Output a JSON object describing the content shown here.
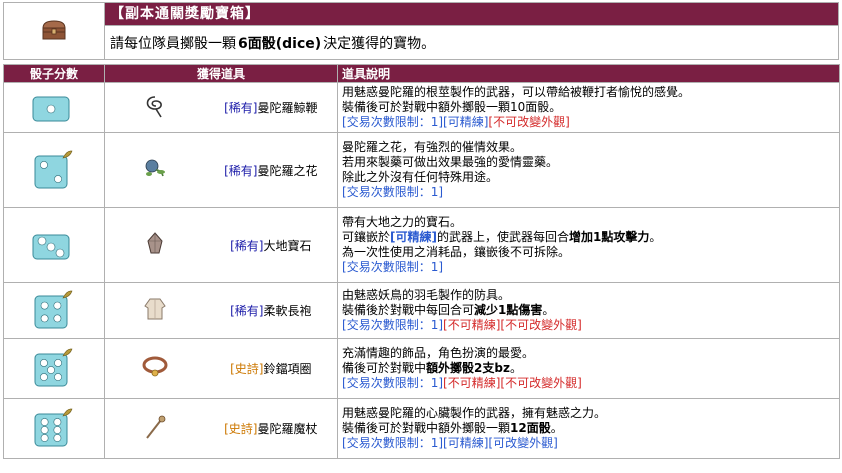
{
  "header": {
    "title": "【副本通關獎勵寶箱】",
    "icon": "treasure-chest-icon",
    "desc_prefix": "請每位隊員擲骰一顆",
    "desc_bold": "6面骰(dice)",
    "desc_suffix": "決定獲得的寶物。"
  },
  "columns": {
    "dice": "骰子分數",
    "item": "獲得道具",
    "desc": "道具說明"
  },
  "rows": [
    {
      "dice_face": 1,
      "item_icon": "whip-icon",
      "item_tag": "[稀有]",
      "item_tag_class": "rare",
      "item_name": "曼陀羅鯨鞭",
      "desc": [
        [
          {
            "t": "用魅惑曼陀羅的根莖製作的武器，可以帶給被鞭打者愉悅的感覺。"
          }
        ],
        [
          {
            "t": "裝備後可於對戰中額外擲骰一顆10面骰。"
          }
        ],
        [
          {
            "t": "[交易次數限制：1]",
            "c": "blue"
          },
          {
            "t": "[可精練]",
            "c": "blue"
          },
          {
            "t": "[不可改變外觀]",
            "c": "red"
          }
        ]
      ]
    },
    {
      "dice_face": 2,
      "item_icon": "flower-icon",
      "item_tag": "[稀有]",
      "item_tag_class": "rare",
      "item_name": "曼陀羅之花",
      "desc": [
        [
          {
            "t": "曼陀羅之花，有強烈的催情效果。"
          }
        ],
        [
          {
            "t": "若用來製藥可做出效果最強的愛情靈藥。"
          }
        ],
        [
          {
            "t": "除此之外沒有任何特殊用途。"
          }
        ],
        [
          {
            "t": "[交易次數限制：1]",
            "c": "blue"
          }
        ]
      ]
    },
    {
      "dice_face": 3,
      "item_icon": "gem-icon",
      "item_tag": "[稀有]",
      "item_tag_class": "rare",
      "item_name": "大地寶石",
      "desc": [
        [
          {
            "t": "帶有大地之力的寶石。"
          }
        ],
        [
          {
            "t": "可鑲嵌於"
          },
          {
            "t": "[可精練]",
            "c": "blue bold"
          },
          {
            "t": "的武器上，使武器每回合"
          },
          {
            "t": "增加1點攻擊力",
            "c": "bold"
          },
          {
            "t": "。"
          }
        ],
        [
          {
            "t": "為一次性使用之消耗品，鑲嵌後不可拆除。"
          }
        ],
        [
          {
            "t": "[交易次數限制：1]",
            "c": "blue"
          }
        ]
      ]
    },
    {
      "dice_face": 4,
      "item_icon": "robe-icon",
      "item_tag": "[稀有]",
      "item_tag_class": "rare",
      "item_name": "柔軟長袍",
      "desc": [
        [
          {
            "t": "由魅惑妖鳥的羽毛製作的防具。"
          }
        ],
        [
          {
            "t": "裝備後於對戰中每回合可"
          },
          {
            "t": "減少1點傷害",
            "c": "bold"
          },
          {
            "t": "。"
          }
        ],
        [
          {
            "t": "[交易次數限制：1]",
            "c": "blue"
          },
          {
            "t": "[不可精練]",
            "c": "red"
          },
          {
            "t": "[不可改變外觀]",
            "c": "red"
          }
        ]
      ]
    },
    {
      "dice_face": 5,
      "item_icon": "collar-icon",
      "item_tag": "[史詩]",
      "item_tag_class": "epic",
      "item_name": "鈴鐺項圈",
      "desc": [
        [
          {
            "t": "充滿情趣的飾品，角色扮演的最愛。"
          }
        ],
        [
          {
            "t": "備後可於對戰中"
          },
          {
            "t": "額外擲骰2支bz",
            "c": "bold"
          },
          {
            "t": "。"
          }
        ],
        [
          {
            "t": "[交易次數限制：1]",
            "c": "blue"
          },
          {
            "t": "[不可精練]",
            "c": "red"
          },
          {
            "t": "[不可改變外觀]",
            "c": "red"
          }
        ]
      ]
    },
    {
      "dice_face": 6,
      "item_icon": "staff-icon",
      "item_tag": "[史詩]",
      "item_tag_class": "epic",
      "item_name": "曼陀羅魔杖",
      "desc": [
        [
          {
            "t": "用魅惑曼陀羅的心臟製作的武器，擁有魅惑之力。"
          }
        ],
        [
          {
            "t": "裝備後可於對戰中額外擲骰一顆"
          },
          {
            "t": "12面骰",
            "c": "bold"
          },
          {
            "t": "。"
          }
        ],
        [
          {
            "t": "[交易次數限制：1]",
            "c": "blue"
          },
          {
            "t": "[可精練]",
            "c": "blue"
          },
          {
            "t": "[可改變外觀]",
            "c": "blue"
          }
        ]
      ]
    }
  ],
  "colors": {
    "header_bg": "#7a1f43",
    "dice_fill": "#8fd6e0",
    "rare": "#1a1aa8",
    "epic": "#cc7700",
    "blue": "#2a5ad0",
    "red": "#d42a2a"
  }
}
